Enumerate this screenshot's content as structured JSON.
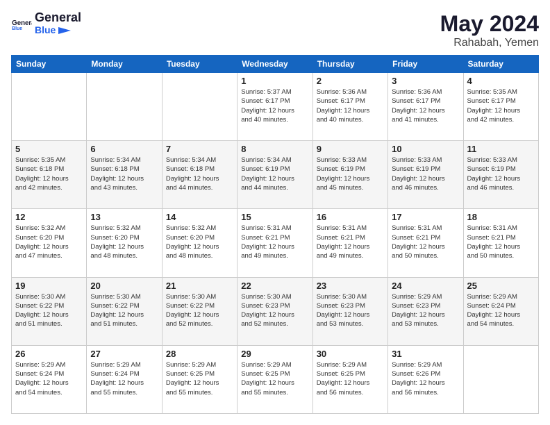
{
  "header": {
    "logo_general": "General",
    "logo_blue": "Blue",
    "month": "May 2024",
    "location": "Rahabah, Yemen"
  },
  "weekdays": [
    "Sunday",
    "Monday",
    "Tuesday",
    "Wednesday",
    "Thursday",
    "Friday",
    "Saturday"
  ],
  "weeks": [
    [
      {
        "day": "",
        "content": ""
      },
      {
        "day": "",
        "content": ""
      },
      {
        "day": "",
        "content": ""
      },
      {
        "day": "1",
        "content": "Sunrise: 5:37 AM\nSunset: 6:17 PM\nDaylight: 12 hours\nand 40 minutes."
      },
      {
        "day": "2",
        "content": "Sunrise: 5:36 AM\nSunset: 6:17 PM\nDaylight: 12 hours\nand 40 minutes."
      },
      {
        "day": "3",
        "content": "Sunrise: 5:36 AM\nSunset: 6:17 PM\nDaylight: 12 hours\nand 41 minutes."
      },
      {
        "day": "4",
        "content": "Sunrise: 5:35 AM\nSunset: 6:17 PM\nDaylight: 12 hours\nand 42 minutes."
      }
    ],
    [
      {
        "day": "5",
        "content": "Sunrise: 5:35 AM\nSunset: 6:18 PM\nDaylight: 12 hours\nand 42 minutes."
      },
      {
        "day": "6",
        "content": "Sunrise: 5:34 AM\nSunset: 6:18 PM\nDaylight: 12 hours\nand 43 minutes."
      },
      {
        "day": "7",
        "content": "Sunrise: 5:34 AM\nSunset: 6:18 PM\nDaylight: 12 hours\nand 44 minutes."
      },
      {
        "day": "8",
        "content": "Sunrise: 5:34 AM\nSunset: 6:19 PM\nDaylight: 12 hours\nand 44 minutes."
      },
      {
        "day": "9",
        "content": "Sunrise: 5:33 AM\nSunset: 6:19 PM\nDaylight: 12 hours\nand 45 minutes."
      },
      {
        "day": "10",
        "content": "Sunrise: 5:33 AM\nSunset: 6:19 PM\nDaylight: 12 hours\nand 46 minutes."
      },
      {
        "day": "11",
        "content": "Sunrise: 5:33 AM\nSunset: 6:19 PM\nDaylight: 12 hours\nand 46 minutes."
      }
    ],
    [
      {
        "day": "12",
        "content": "Sunrise: 5:32 AM\nSunset: 6:20 PM\nDaylight: 12 hours\nand 47 minutes."
      },
      {
        "day": "13",
        "content": "Sunrise: 5:32 AM\nSunset: 6:20 PM\nDaylight: 12 hours\nand 48 minutes."
      },
      {
        "day": "14",
        "content": "Sunrise: 5:32 AM\nSunset: 6:20 PM\nDaylight: 12 hours\nand 48 minutes."
      },
      {
        "day": "15",
        "content": "Sunrise: 5:31 AM\nSunset: 6:21 PM\nDaylight: 12 hours\nand 49 minutes."
      },
      {
        "day": "16",
        "content": "Sunrise: 5:31 AM\nSunset: 6:21 PM\nDaylight: 12 hours\nand 49 minutes."
      },
      {
        "day": "17",
        "content": "Sunrise: 5:31 AM\nSunset: 6:21 PM\nDaylight: 12 hours\nand 50 minutes."
      },
      {
        "day": "18",
        "content": "Sunrise: 5:31 AM\nSunset: 6:21 PM\nDaylight: 12 hours\nand 50 minutes."
      }
    ],
    [
      {
        "day": "19",
        "content": "Sunrise: 5:30 AM\nSunset: 6:22 PM\nDaylight: 12 hours\nand 51 minutes."
      },
      {
        "day": "20",
        "content": "Sunrise: 5:30 AM\nSunset: 6:22 PM\nDaylight: 12 hours\nand 51 minutes."
      },
      {
        "day": "21",
        "content": "Sunrise: 5:30 AM\nSunset: 6:22 PM\nDaylight: 12 hours\nand 52 minutes."
      },
      {
        "day": "22",
        "content": "Sunrise: 5:30 AM\nSunset: 6:23 PM\nDaylight: 12 hours\nand 52 minutes."
      },
      {
        "day": "23",
        "content": "Sunrise: 5:30 AM\nSunset: 6:23 PM\nDaylight: 12 hours\nand 53 minutes."
      },
      {
        "day": "24",
        "content": "Sunrise: 5:29 AM\nSunset: 6:23 PM\nDaylight: 12 hours\nand 53 minutes."
      },
      {
        "day": "25",
        "content": "Sunrise: 5:29 AM\nSunset: 6:24 PM\nDaylight: 12 hours\nand 54 minutes."
      }
    ],
    [
      {
        "day": "26",
        "content": "Sunrise: 5:29 AM\nSunset: 6:24 PM\nDaylight: 12 hours\nand 54 minutes."
      },
      {
        "day": "27",
        "content": "Sunrise: 5:29 AM\nSunset: 6:24 PM\nDaylight: 12 hours\nand 55 minutes."
      },
      {
        "day": "28",
        "content": "Sunrise: 5:29 AM\nSunset: 6:25 PM\nDaylight: 12 hours\nand 55 minutes."
      },
      {
        "day": "29",
        "content": "Sunrise: 5:29 AM\nSunset: 6:25 PM\nDaylight: 12 hours\nand 55 minutes."
      },
      {
        "day": "30",
        "content": "Sunrise: 5:29 AM\nSunset: 6:25 PM\nDaylight: 12 hours\nand 56 minutes."
      },
      {
        "day": "31",
        "content": "Sunrise: 5:29 AM\nSunset: 6:26 PM\nDaylight: 12 hours\nand 56 minutes."
      },
      {
        "day": "",
        "content": ""
      }
    ]
  ]
}
